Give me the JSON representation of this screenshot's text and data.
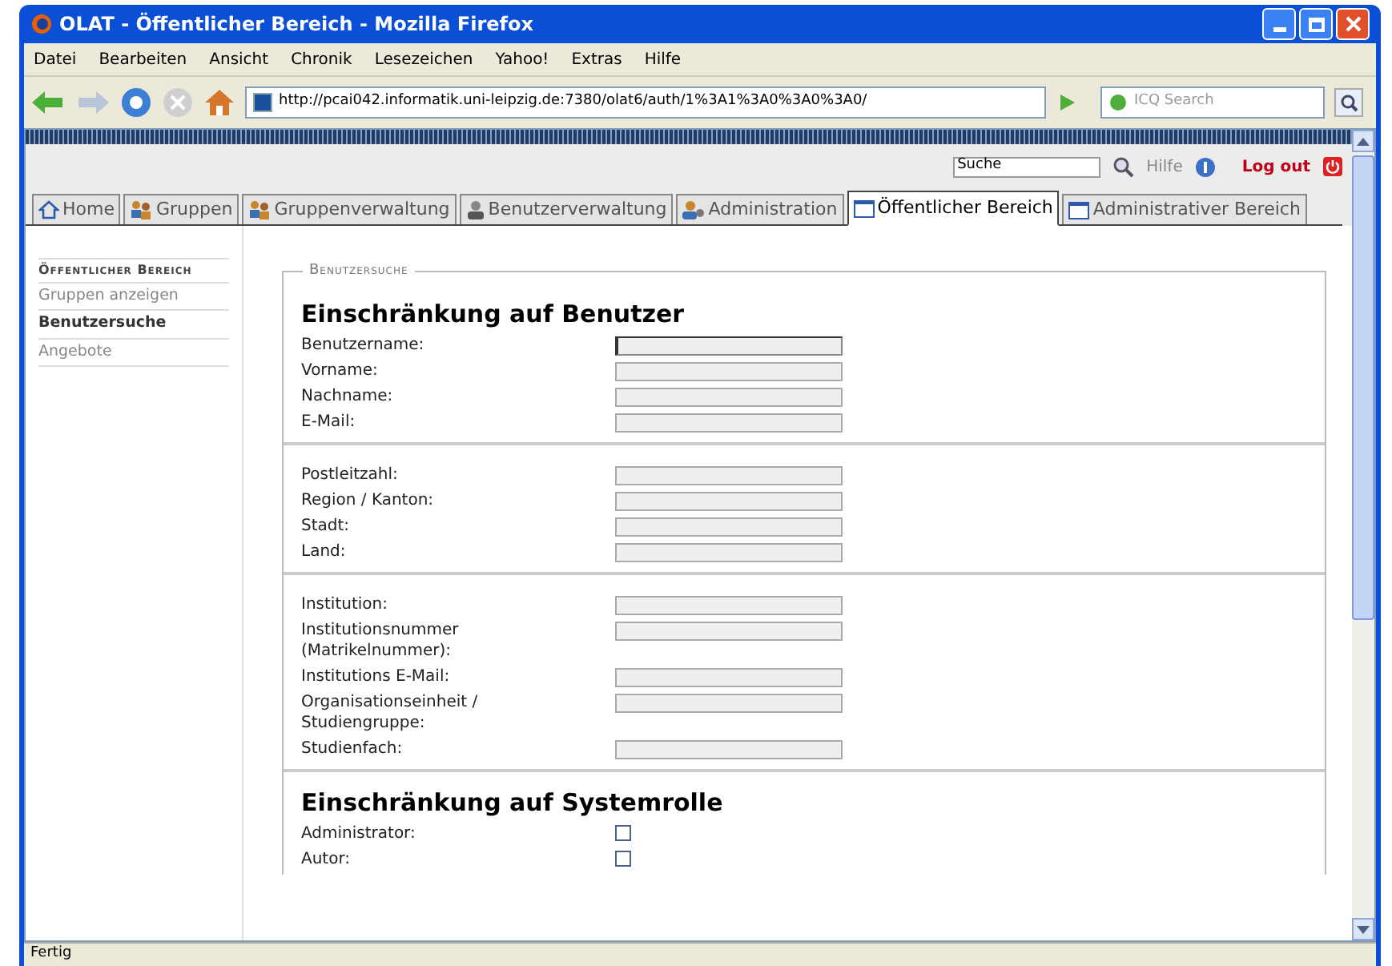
{
  "window": {
    "title": "OLAT - Öffentlicher Bereich - Mozilla Firefox"
  },
  "menu": [
    "Datei",
    "Bearbeiten",
    "Ansicht",
    "Chronik",
    "Lesezeichen",
    "Yahoo!",
    "Extras",
    "Hilfe"
  ],
  "address_bar": {
    "url": "http://pcai042.informatik.uni-leipzig.de:7380/olat6/auth/1%3A1%3A0%3A0%3A0/"
  },
  "browser_search": {
    "placeholder": "ICQ Search"
  },
  "top_bar": {
    "search_value": "Suche",
    "help": "Hilfe",
    "logout": "Log out"
  },
  "tabs": [
    {
      "label": "Home",
      "selected": false
    },
    {
      "label": "Gruppen",
      "selected": false
    },
    {
      "label": "Gruppenverwaltung",
      "selected": false
    },
    {
      "label": "Benutzerverwaltung",
      "selected": false
    },
    {
      "label": "Administration",
      "selected": false
    },
    {
      "label": "Öffentlicher Bereich",
      "selected": true
    },
    {
      "label": "Administrativer Bereich",
      "selected": false
    }
  ],
  "sidebar": {
    "heading": "Öffentlicher Bereich",
    "items": [
      {
        "label": "Gruppen anzeigen",
        "selected": false
      },
      {
        "label": "Benutzersuche",
        "selected": true
      },
      {
        "label": "Angebote",
        "selected": false
      }
    ]
  },
  "form": {
    "legend": "Benutzersuche",
    "sections": [
      {
        "heading": "Einschränkung auf Benutzer",
        "groups": [
          [
            {
              "label": "Benutzername:",
              "kind": "text",
              "focused": true
            },
            {
              "label": "Vorname:",
              "kind": "text",
              "focused": false
            },
            {
              "label": "Nachname:",
              "kind": "text",
              "focused": false
            },
            {
              "label": "E-Mail:",
              "kind": "text",
              "focused": false
            }
          ],
          [
            {
              "label": "Postleitzahl:",
              "kind": "text",
              "focused": false
            },
            {
              "label": "Region / Kanton:",
              "kind": "text",
              "focused": false
            },
            {
              "label": "Stadt:",
              "kind": "text",
              "focused": false
            },
            {
              "label": "Land:",
              "kind": "text",
              "focused": false
            }
          ],
          [
            {
              "label": "Institution:",
              "kind": "text",
              "focused": false
            },
            {
              "label": "Institutionsnummer (Matrikelnummer):",
              "kind": "text",
              "focused": false
            },
            {
              "label": "Institutions E-Mail:",
              "kind": "text",
              "focused": false
            },
            {
              "label": "Organisationseinheit / Studiengruppe:",
              "kind": "text",
              "focused": false
            },
            {
              "label": "Studienfach:",
              "kind": "text",
              "focused": false
            }
          ]
        ]
      },
      {
        "heading": "Einschränkung auf Systemrolle",
        "groups": [
          [
            {
              "label": "Administrator:",
              "kind": "checkbox",
              "checked": false
            },
            {
              "label": "Autor:",
              "kind": "checkbox",
              "checked": false
            }
          ]
        ]
      }
    ]
  },
  "status_bar": {
    "text": "Fertig"
  }
}
